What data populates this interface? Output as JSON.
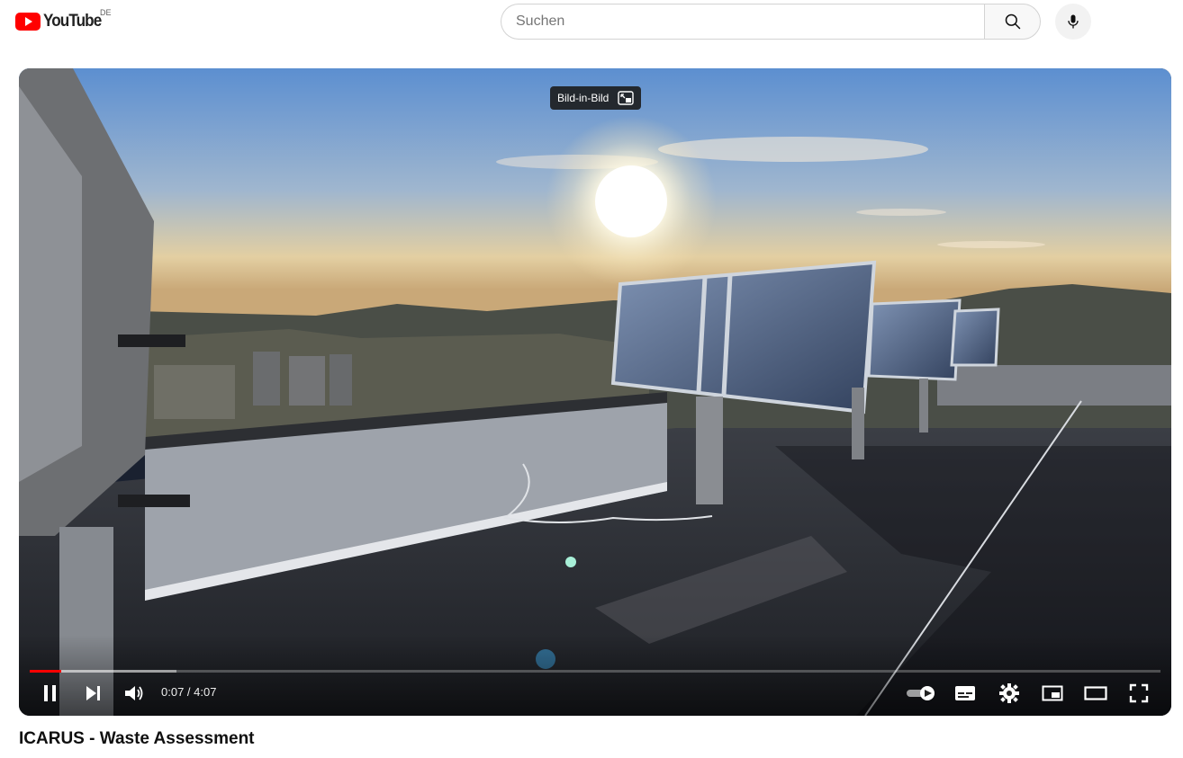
{
  "header": {
    "logo_text": "YouTube",
    "region_code": "DE",
    "search_placeholder": "Suchen"
  },
  "player": {
    "pip_tooltip": "Bild-in-Bild",
    "current_time": "0:07",
    "time_separator": " / ",
    "duration": "4:07",
    "progress_played_fraction": 0.028,
    "progress_buffered_fraction": 0.13
  },
  "video": {
    "title": "ICARUS - Waste Assessment"
  },
  "colors": {
    "brand_red": "#ff0000",
    "text_primary": "#0f0f0f"
  },
  "icons": [
    "youtube-logo-icon",
    "search-icon",
    "microphone-icon",
    "pip-icon",
    "pause-icon",
    "next-icon",
    "volume-icon",
    "autoplay-toggle-icon",
    "subtitles-icon",
    "settings-icon",
    "miniplayer-icon",
    "theater-mode-icon",
    "fullscreen-icon"
  ]
}
